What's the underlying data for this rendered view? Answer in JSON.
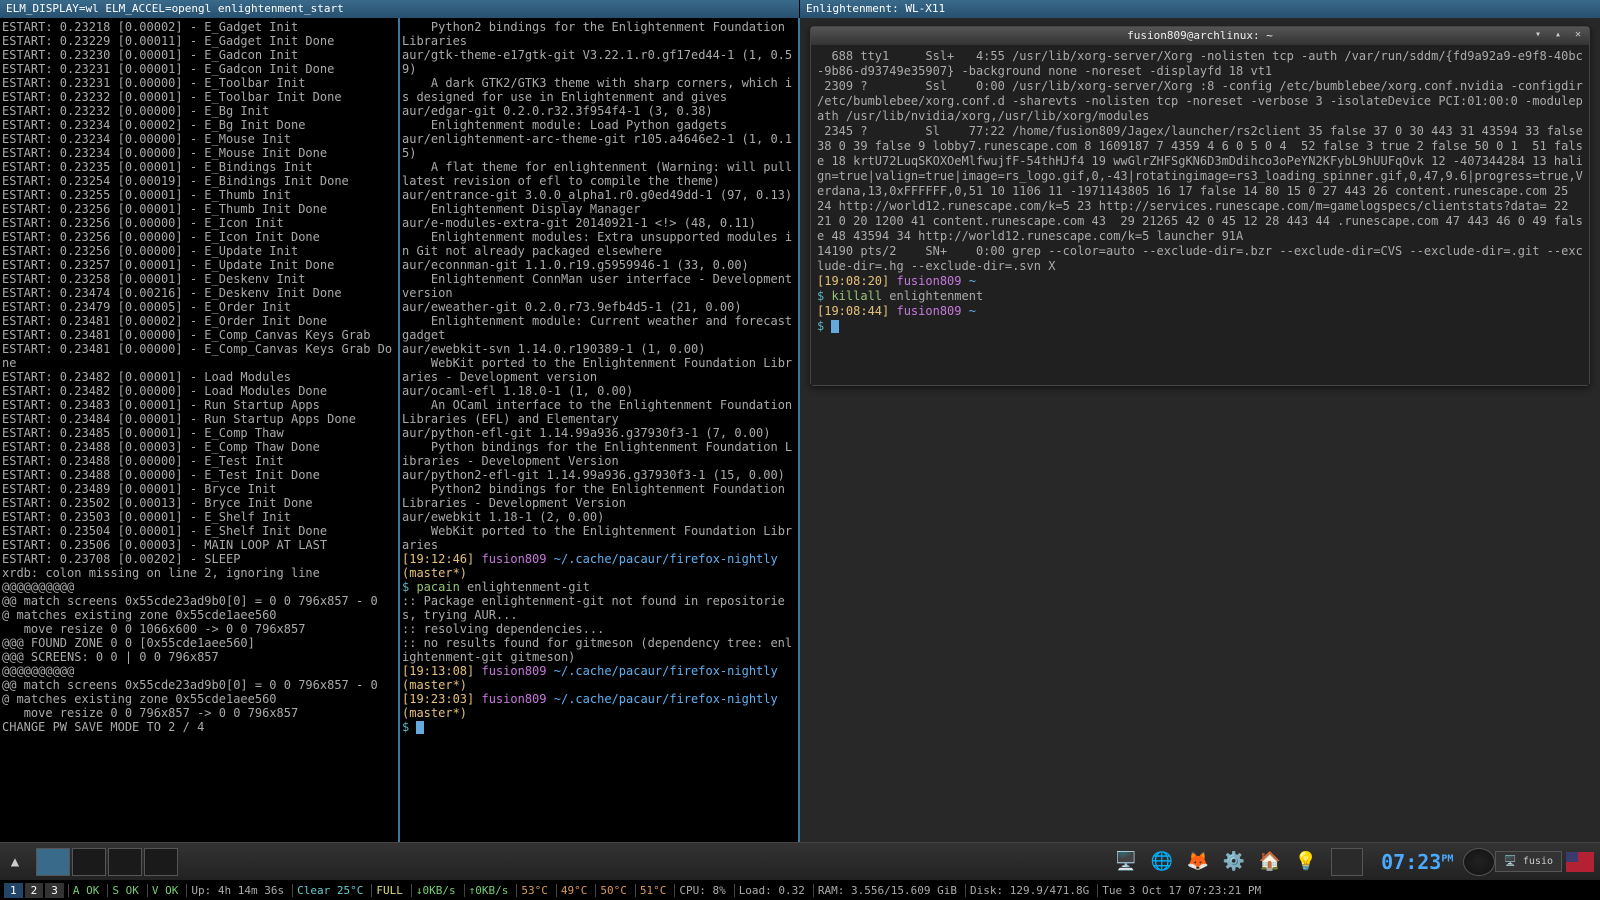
{
  "titlebar_left": "ELM_DISPLAY=wl ELM_ACCEL=opengl enlightenment_start",
  "titlebar_right": "Enlightenment: WL-X11",
  "terminal_title": "fusion809@archlinux: ~",
  "left_pane": "ESTART: 0.23218 [0.00002] - E_Gadget Init\nESTART: 0.23229 [0.00011] - E_Gadget Init Done\nESTART: 0.23230 [0.00001] - E_Gadcon Init\nESTART: 0.23231 [0.00001] - E_Gadcon Init Done\nESTART: 0.23231 [0.00000] - E_Toolbar Init\nESTART: 0.23232 [0.00001] - E_Toolbar Init Done\nESTART: 0.23232 [0.00000] - E_Bg Init\nESTART: 0.23234 [0.00002] - E_Bg Init Done\nESTART: 0.23234 [0.00000] - E_Mouse Init\nESTART: 0.23234 [0.00000] - E_Mouse Init Done\nESTART: 0.23235 [0.00001] - E_Bindings Init\nESTART: 0.23254 [0.00019] - E_Bindings Init Done\nESTART: 0.23255 [0.00001] - E_Thumb Init\nESTART: 0.23256 [0.00001] - E_Thumb Init Done\nESTART: 0.23256 [0.00000] - E_Icon Init\nESTART: 0.23256 [0.00000] - E_Icon Init Done\nESTART: 0.23256 [0.00000] - E_Update Init\nESTART: 0.23257 [0.00001] - E_Update Init Done\nESTART: 0.23258 [0.00001] - E_Deskenv Init\nESTART: 0.23474 [0.00216] - E_Deskenv Init Done\nESTART: 0.23479 [0.00005] - E_Order Init\nESTART: 0.23481 [0.00002] - E_Order Init Done\nESTART: 0.23481 [0.00000] - E_Comp_Canvas Keys Grab\nESTART: 0.23481 [0.00000] - E_Comp_Canvas Keys Grab Done\nESTART: 0.23482 [0.00001] - Load Modules\nESTART: 0.23482 [0.00000] - Load Modules Done\nESTART: 0.23483 [0.00001] - Run Startup Apps\nESTART: 0.23484 [0.00001] - Run Startup Apps Done\nESTART: 0.23485 [0.00001] - E_Comp Thaw\nESTART: 0.23488 [0.00003] - E_Comp Thaw Done\nESTART: 0.23488 [0.00000] - E_Test Init\nESTART: 0.23488 [0.00000] - E_Test Init Done\nESTART: 0.23489 [0.00001] - Bryce Init\nESTART: 0.23502 [0.00013] - Bryce Init Done\nESTART: 0.23503 [0.00001] - E_Shelf Init\nESTART: 0.23504 [0.00001] - E_Shelf Init Done\nESTART: 0.23506 [0.00003] - MAIN LOOP AT LAST\nESTART: 0.23708 [0.00202] - SLEEP\nxrdb: colon missing on line 2, ignoring line\n@@@@@@@@@@\n@@ match screens 0x55cde23ad9b0[0] = 0 0 796x857 - 0\n@ matches existing zone 0x55cde1aee560\n   move resize 0 0 1066x600 -> 0 0 796x857\n@@@ FOUND ZONE 0 0 [0x55cde1aee560]\n@@@ SCREENS: 0 0 | 0 0 796x857\n@@@@@@@@@@\n@@ match screens 0x55cde23ad9b0[0] = 0 0 796x857 - 0\n@ matches existing zone 0x55cde1aee560\n   move resize 0 0 796x857 -> 0 0 796x857\nCHANGE PW SAVE MODE TO 2 / 4",
  "mid_pane_plain": "    Python2 bindings for the Enlightenment Foundation Libraries\naur/gtk-theme-e17gtk-git V3.22.1.r0.gf17ed44-1 (1, 0.59)\n    A dark GTK2/GTK3 theme with sharp corners, which is designed for use in Enlightenment and gives\naur/edgar-git 0.2.0.r32.3f954f4-1 (3, 0.38)\n    Enlightenment module: Load Python gadgets\naur/enlightenment-arc-theme-git r105.a4646e2-1 (1, 0.15)\n    A flat theme for enlightenment (Warning: will pull latest revision of efl to compile the theme)\naur/entrance-git 3.0.0_alpha1.r0.g0ed49dd-1 (97, 0.13)\n    Enlightenment Display Manager\naur/e-modules-extra-git 20140921-1 <!> (48, 0.11)\n    Enlightenment modules: Extra unsupported modules in Git not already packaged elsewhere\naur/econnman-git 1.1.0.r19.g5959946-1 (33, 0.00)\n    Enlightenment ConnMan user interface - Development version\naur/eweather-git 0.2.0.r73.9efb4d5-1 (21, 0.00)\n    Enlightenment module: Current weather and forecast gadget\naur/ewebkit-svn 1.14.0.r190389-1 (1, 0.00)\n    WebKit ported to the Enlightenment Foundation Libraries - Development version\naur/ocaml-efl 1.18.0-1 (1, 0.00)\n    An OCaml interface to the Enlightenment Foundation Libraries (EFL) and Elementary\naur/python-efl-git 1.14.99a936.g37930f3-1 (7, 0.00)\n    Python bindings for the Enlightenment Foundation Libraries - Development Version\naur/python2-efl-git 1.14.99a936.g37930f3-1 (15, 0.00)\n    Python2 bindings for the Enlightenment Foundation Libraries - Development Version\naur/ewebkit 1.18-1 (2, 0.00)\n    WebKit ported to the Enlightenment Foundation Libraries",
  "mid_prompt1_time": "[19:12:46]",
  "mid_prompt1_user": "fusion809",
  "mid_prompt1_path": "~/.cache/pacaur/firefox-nightly",
  "mid_prompt1_branch": "(master*)",
  "mid_prompt1_cmd": "pacain",
  "mid_prompt1_arg": "enlightenment-git",
  "mid_output1": ":: Package enlightenment-git not found in repositories, trying AUR...\n:: resolving dependencies...\n:: no results found for gitmeson (dependency tree: enlightenment-git gitmeson)",
  "mid_prompt2_time": "[19:13:08]",
  "mid_prompt3_time": "[19:23:03]",
  "right_top": "  688 tty1     Ssl+   4:55 /usr/lib/xorg-server/Xorg -nolisten tcp -auth /var/run/sddm/{fd9a92a9-e9f8-40bc-9b86-d93749e35907} -background none -noreset -displayfd 18 vt1\n 2309 ?        Ssl    0:00 /usr/lib/xorg-server/Xorg :8 -config /etc/bumblebee/xorg.conf.nvidia -configdir /etc/bumblebee/xorg.conf.d -sharevts -nolisten tcp -noreset -verbose 3 -isolateDevice PCI:01:00:0 -modulepath /usr/lib/nvidia/xorg,/usr/lib/xorg/modules\n 2345 ?        Sl    77:22 /home/fusion809/Jagex/launcher/rs2client 35 false 37 0 30 443 31 43594 33 false 38 0 39 false 9 lobby7.runescape.com 8 1609187 7 4359 4 6 0 5 0 4  52 false 3 true 2 false 50 0 1  51 false 18 krtU72LuqSKOXOeMlfwujfF-54thHJf4 19 wwGlrZHFSgKN6D3mDdihco3oPeYN2KFybL9hUUFqOvk 12 -407344284 13 halign=true|valign=true|image=rs_logo.gif,0,-43|rotatingimage=rs3_loading_spinner.gif,0,47,9.6|progress=true,Verdana,13,0xFFFFFF,0,51 10 1106 11 -1971143805 16 17 false 14 80 15 0 27 443 26 content.runescape.com 25  24 http://world12.runescape.com/k=5 23 http://services.runescape.com/m=gamelogspecs/clientstats?data= 22  21 0 20 1200 41 content.runescape.com 43  29 21265 42 0 45 12 28 443 44 .runescape.com 47 443 46 0 49 false 48 43594 34 http://world12.runescape.com/k=5 launcher 91A\n14190 pts/2    SN+    0:00 grep --color=auto --exclude-dir=.bzr --exclude-dir=CVS --exclude-dir=.git --exclude-dir=.hg --exclude-dir=.svn X",
  "right_p1_time": "[19:08:20]",
  "right_p1_user": "fusion809",
  "right_p1_path": "~",
  "right_cmd1": "killall",
  "right_arg1": "enlightenment",
  "right_p2_time": "[19:08:44]",
  "taskbar_tasks": [
    "fusio"
  ],
  "clock_time": "07:23",
  "clock_ampm": "PM",
  "statusbar": {
    "tabs": [
      "1",
      "2",
      "3"
    ],
    "aok": "A OK",
    "sok": "S OK",
    "vok": "V OK",
    "up": "Up: 4h 14m 36s",
    "weather": "Clear 25°C",
    "bat": "FULL",
    "net_down": "0KB/s",
    "net_up": "0KB/s",
    "t1": "53°C",
    "t2": "49°C",
    "t3": "50°C",
    "t4": "51°C",
    "cpu": "CPU: 8%",
    "load": "Load: 0.32",
    "ram": "RAM: 3.556/15.609 GiB",
    "disk": "Disk: 129.9/471.8G",
    "date": "Tue 3 Oct 17 07:23:21 PM"
  }
}
